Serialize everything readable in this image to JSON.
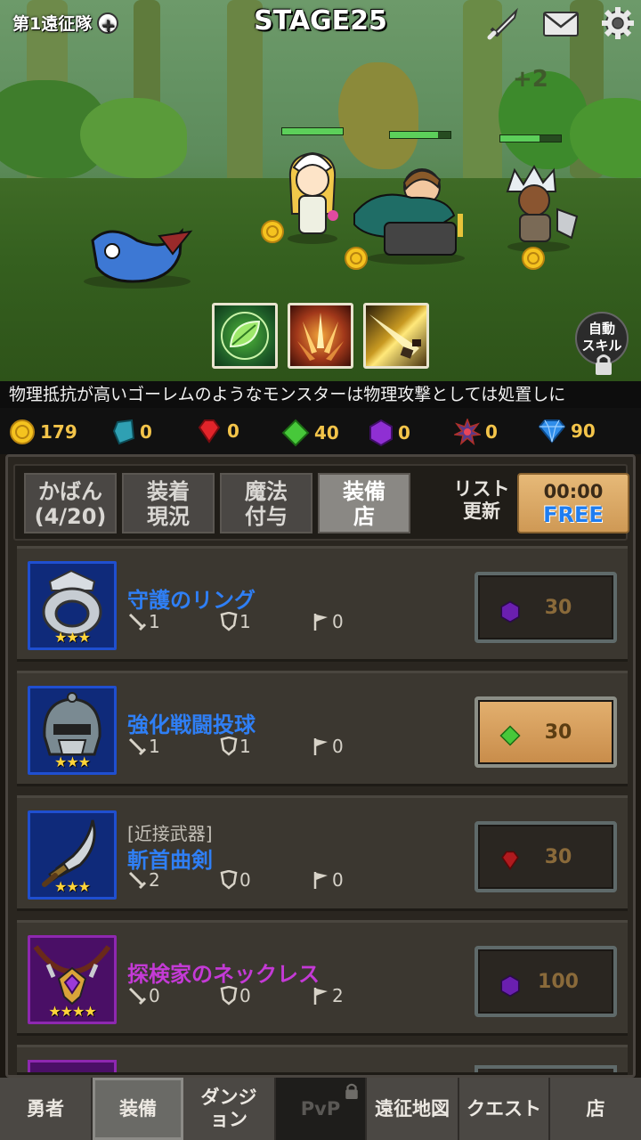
{
  "header": {
    "party_label": "第1遠征隊",
    "stage": "STAGE25",
    "floating_text": "+2"
  },
  "skills": {
    "auto_skill_label": "自動\nスキル"
  },
  "tip": "物理抵抗が高いゴーレムのようなモンスターは物理攻撃としては処置しに",
  "currency": [
    {
      "icon": "gold-coin-icon",
      "value": "179"
    },
    {
      "icon": "teal-stone-icon",
      "value": "0"
    },
    {
      "icon": "red-gem-icon",
      "value": "0"
    },
    {
      "icon": "green-gem-icon",
      "value": "40"
    },
    {
      "icon": "purple-gem-icon",
      "value": "0"
    },
    {
      "icon": "dark-orb-icon",
      "value": "0"
    },
    {
      "icon": "blue-diamond-icon",
      "value": "90"
    }
  ],
  "tabs": [
    {
      "label": "かばん\n(4/20)",
      "active": false
    },
    {
      "label": "装着\n現況",
      "active": false
    },
    {
      "label": "魔法\n付与",
      "active": false
    },
    {
      "label": "装備\n店",
      "active": true
    }
  ],
  "refresh": {
    "label": "リスト\n更新",
    "time": "00:00",
    "free": "FREE"
  },
  "items": [
    {
      "name": "守護のリング",
      "category": "",
      "stars": "★★★",
      "atk": "1",
      "def": "1",
      "flag": "0",
      "currency": "purple",
      "price": "30",
      "buyable": false,
      "name_color": "#2f7ff5",
      "frame": "#1f4fd0"
    },
    {
      "name": "強化戦闘投球",
      "category": "",
      "stars": "★★★",
      "atk": "1",
      "def": "1",
      "flag": "0",
      "currency": "green",
      "price": "30",
      "buyable": true,
      "name_color": "#2f7ff5",
      "frame": "#1f4fd0"
    },
    {
      "name": "斬首曲剣",
      "category": "[近接武器]",
      "stars": "★★★",
      "atk": "2",
      "def": "0",
      "flag": "0",
      "currency": "red",
      "price": "30",
      "buyable": false,
      "name_color": "#2f7ff5",
      "frame": "#1f4fd0"
    },
    {
      "name": "探検家のネックレス",
      "category": "",
      "stars": "★★★★",
      "atk": "0",
      "def": "0",
      "flag": "2",
      "currency": "purple",
      "price": "100",
      "buyable": false,
      "name_color": "#c43ad6",
      "frame": "#8e28b0"
    }
  ],
  "nav": [
    {
      "label": "勇者",
      "state": "normal"
    },
    {
      "label": "装備",
      "state": "active"
    },
    {
      "label": "ダンジ\nョン",
      "state": "normal"
    },
    {
      "label": "PvP",
      "state": "disabled"
    },
    {
      "label": "遠征地図",
      "state": "normal"
    },
    {
      "label": "クエスト",
      "state": "normal"
    },
    {
      "label": "店",
      "state": "normal"
    }
  ]
}
